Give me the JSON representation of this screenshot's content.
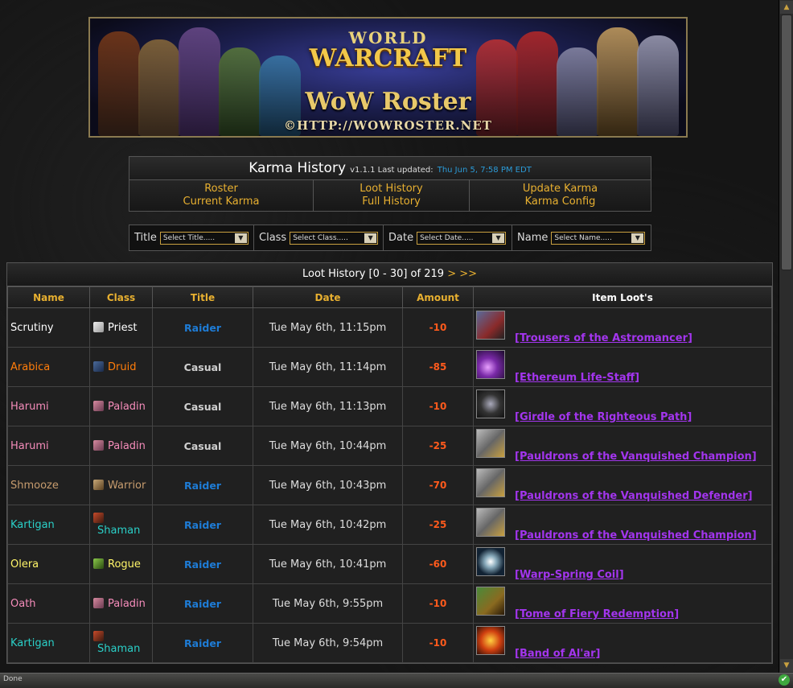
{
  "banner": {
    "world": "WORLD",
    "warcraft": "WARCRAFT",
    "title": "WoW Roster",
    "url": "©HTTP://WOWROSTER.NET"
  },
  "header": {
    "title": "Karma History",
    "version": "v1.1.1 Last updated:",
    "updated": "Thu Jun 5, 7:58 PM EDT"
  },
  "menu": {
    "roster": "Roster",
    "current_karma": "Current Karma",
    "loot_history": "Loot History",
    "full_history": "Full History",
    "update_karma": "Update Karma",
    "karma_config": "Karma Config"
  },
  "filters": {
    "title_label": "Title",
    "title_value": "Select Title.....",
    "class_label": "Class",
    "class_value": "Select Class.....",
    "date_label": "Date",
    "date_value": "Select Date.....",
    "name_label": "Name",
    "name_value": "Select Name....."
  },
  "loot": {
    "caption": "Loot History [0 - 30] of 219",
    "nav": "> >>",
    "headers": [
      "Name",
      "Class",
      "Title",
      "Date",
      "Amount",
      "Item Loot's"
    ],
    "rows": [
      {
        "name": "Scrutiny",
        "class": "Priest",
        "title": "Raider",
        "date": "Tue May 6th, 11:15pm",
        "amount": "-10",
        "item": "[Trousers of the Astromancer]"
      },
      {
        "name": "Arabica",
        "class": "Druid",
        "title": "Casual",
        "date": "Tue May 6th, 11:14pm",
        "amount": "-85",
        "item": "[Ethereum Life-Staff]"
      },
      {
        "name": "Harumi",
        "class": "Paladin",
        "title": "Casual",
        "date": "Tue May 6th, 11:13pm",
        "amount": "-10",
        "item": "[Girdle of the Righteous Path]"
      },
      {
        "name": "Harumi",
        "class": "Paladin",
        "title": "Casual",
        "date": "Tue May 6th, 10:44pm",
        "amount": "-25",
        "item": "[Pauldrons of the Vanquished Champion]"
      },
      {
        "name": "Shmooze",
        "class": "Warrior",
        "title": "Raider",
        "date": "Tue May 6th, 10:43pm",
        "amount": "-70",
        "item": "[Pauldrons of the Vanquished Defender]"
      },
      {
        "name": "Kartigan",
        "class": "Shaman",
        "title": "Raider",
        "date": "Tue May 6th, 10:42pm",
        "amount": "-25",
        "item": "[Pauldrons of the Vanquished Champion]"
      },
      {
        "name": "Olera",
        "class": "Rogue",
        "title": "Raider",
        "date": "Tue May 6th, 10:41pm",
        "amount": "-60",
        "item": "[Warp-Spring Coil]"
      },
      {
        "name": "Oath",
        "class": "Paladin",
        "title": "Raider",
        "date": "Tue May 6th, 9:55pm",
        "amount": "-10",
        "item": "[Tome of Fiery Redemption]"
      },
      {
        "name": "Kartigan",
        "class": "Shaman",
        "title": "Raider",
        "date": "Tue May 6th, 9:54pm",
        "amount": "-10",
        "item": "[Band of Al'ar]"
      }
    ]
  },
  "colors": {
    "Priest": "#ffffff",
    "Druid": "#ff7d0a",
    "Paladin": "#f58cba",
    "Warrior": "#c79c6e",
    "Shaman": "#2ad0c8",
    "Rogue": "#fff569",
    "Raider": "#1e7cd6",
    "Casual": "#cfcfcf",
    "epic": "#a335ee",
    "gold": "#e8b030"
  },
  "statusbar": {
    "text": "Done"
  }
}
